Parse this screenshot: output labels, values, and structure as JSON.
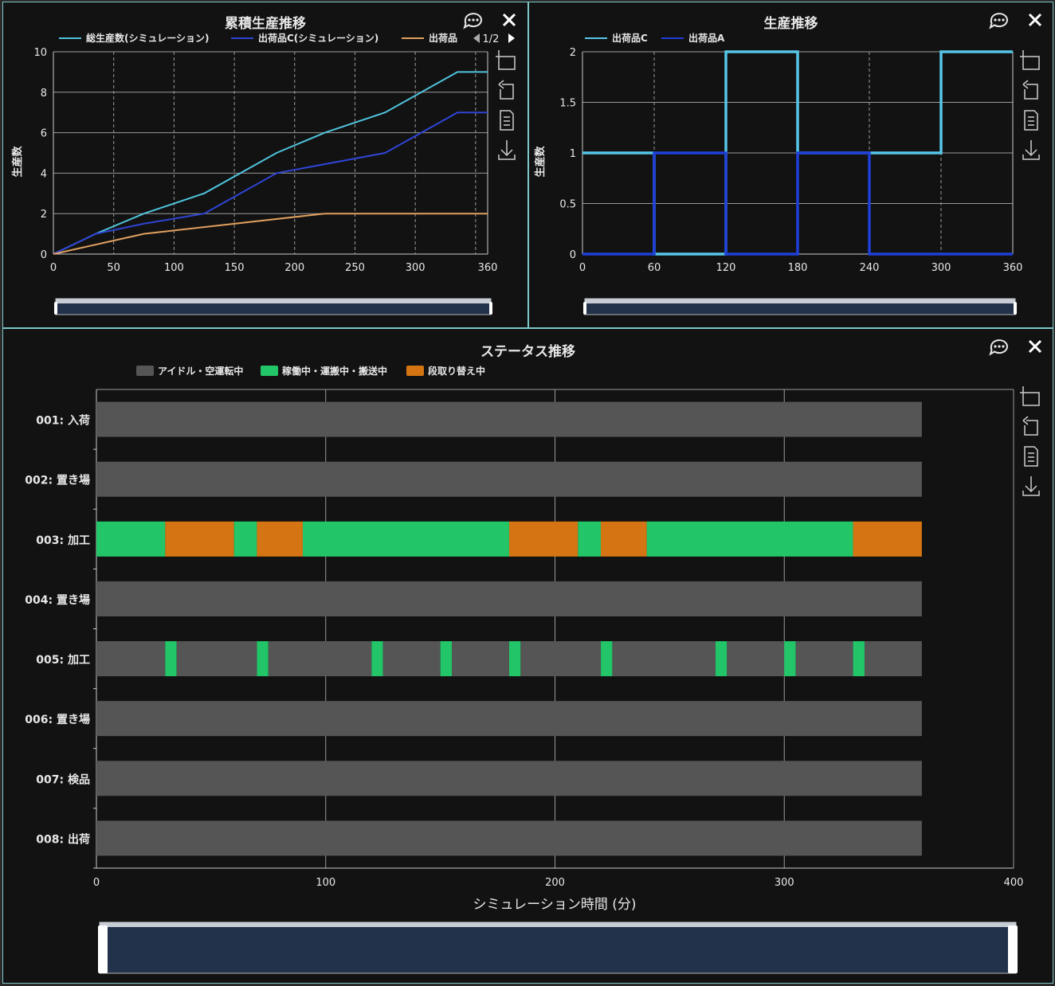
{
  "colors": {
    "total_sim": "#4fc3dc",
    "c_sim": "#2f45d6",
    "other": "#e0a060",
    "c_step": "#56c6e8",
    "a_step": "#1e3fd8",
    "idle": "#555555",
    "run": "#22c567",
    "setup": "#d57412"
  },
  "panel1": {
    "title": "累積生産推移",
    "legend_page": "1/2",
    "icons": [
      "chat-icon",
      "close-icon",
      "zoom-icon",
      "undo-zoom-icon",
      "data-view-icon",
      "download-icon"
    ],
    "chart_data": {
      "type": "line",
      "title": "累積生産推移",
      "ylabel": "生産数",
      "xlim": [
        0,
        360
      ],
      "ylim": [
        0,
        10
      ],
      "x_ticks": [
        0,
        50,
        100,
        150,
        200,
        250,
        300,
        360
      ],
      "y_ticks": [
        0,
        2,
        4,
        6,
        8,
        10
      ],
      "x_grid": [
        50,
        100,
        150,
        200,
        250,
        300,
        350
      ],
      "series": [
        {
          "name": "総生産数(シミュレーション)",
          "legend_label": "総生産数(シミュレーション)",
          "points": [
            [
              0,
              0
            ],
            [
              35,
              1
            ],
            [
              75,
              2
            ],
            [
              125,
              3
            ],
            [
              185,
              5
            ],
            [
              225,
              6
            ],
            [
              275,
              7
            ],
            [
              335,
              9
            ],
            [
              360,
              9
            ]
          ]
        },
        {
          "name": "出荷品C(シミュレーション)",
          "legend_label": "出荷品C(シミュレーション)",
          "points": [
            [
              0,
              0
            ],
            [
              35,
              1
            ],
            [
              75,
              1.5
            ],
            [
              125,
              2
            ],
            [
              185,
              4
            ],
            [
              275,
              5
            ],
            [
              335,
              7
            ],
            [
              360,
              7
            ]
          ]
        },
        {
          "name": "出荷品",
          "legend_label": "出荷品",
          "points": [
            [
              0,
              0
            ],
            [
              75,
              1
            ],
            [
              225,
              2
            ],
            [
              360,
              2
            ]
          ]
        }
      ]
    }
  },
  "panel2": {
    "title": "生産推移",
    "icons": [
      "chat-icon",
      "close-icon",
      "zoom-icon",
      "undo-zoom-icon",
      "data-view-icon",
      "download-icon"
    ],
    "chart_data": {
      "type": "line",
      "title": "生産推移",
      "ylabel": "生産数",
      "xlim": [
        0,
        360
      ],
      "ylim": [
        0,
        2
      ],
      "x_ticks": [
        0,
        60,
        120,
        180,
        240,
        300,
        360
      ],
      "y_ticks": [
        0,
        0.5,
        1,
        1.5,
        2
      ],
      "step": true,
      "series": [
        {
          "name": "出荷品C",
          "legend_label": "出荷品C",
          "points": [
            [
              0,
              1
            ],
            [
              60,
              0
            ],
            [
              120,
              2
            ],
            [
              180,
              1
            ],
            [
              240,
              1
            ],
            [
              300,
              2
            ],
            [
              360,
              2
            ]
          ]
        },
        {
          "name": "出荷品A",
          "legend_label": "出荷品A",
          "points": [
            [
              0,
              0
            ],
            [
              60,
              1
            ],
            [
              120,
              0
            ],
            [
              180,
              1
            ],
            [
              240,
              0
            ],
            [
              300,
              0
            ],
            [
              360,
              0
            ]
          ]
        }
      ]
    }
  },
  "panel3": {
    "title": "ステータス推移",
    "icons": [
      "chat-icon",
      "close-icon",
      "zoom-icon",
      "undo-zoom-icon",
      "data-view-icon",
      "download-icon"
    ],
    "chart_data": {
      "type": "bar",
      "title": "ステータス推移",
      "xlabel": "シミュレーション時間 (分)",
      "xlim": [
        0,
        400
      ],
      "x_ticks": [
        0,
        100,
        200,
        300,
        400
      ],
      "legend": [
        {
          "name": "アイドル・空運転中",
          "key": "idle"
        },
        {
          "name": "稼働中・運搬中・搬送中",
          "key": "run"
        },
        {
          "name": "段取り替え中",
          "key": "setup"
        }
      ],
      "categories": [
        "001: 入荷",
        "002: 置き場",
        "003: 加工",
        "004: 置き場",
        "005: 加工",
        "006: 置き場",
        "007: 検品",
        "008: 出荷"
      ],
      "rows": [
        [
          [
            "idle",
            0,
            360
          ]
        ],
        [
          [
            "idle",
            0,
            360
          ]
        ],
        [
          [
            "run",
            0,
            30
          ],
          [
            "setup",
            30,
            60
          ],
          [
            "run",
            60,
            70
          ],
          [
            "setup",
            70,
            90
          ],
          [
            "run",
            90,
            180
          ],
          [
            "setup",
            180,
            210
          ],
          [
            "run",
            210,
            220
          ],
          [
            "setup",
            220,
            240
          ],
          [
            "run",
            240,
            330
          ],
          [
            "setup",
            330,
            360
          ]
        ],
        [
          [
            "idle",
            0,
            360
          ]
        ],
        [
          [
            "idle",
            0,
            30
          ],
          [
            "run",
            30,
            35
          ],
          [
            "idle",
            35,
            70
          ],
          [
            "run",
            70,
            75
          ],
          [
            "idle",
            75,
            120
          ],
          [
            "run",
            120,
            125
          ],
          [
            "idle",
            125,
            150
          ],
          [
            "run",
            150,
            155
          ],
          [
            "idle",
            155,
            180
          ],
          [
            "run",
            180,
            185
          ],
          [
            "idle",
            185,
            220
          ],
          [
            "run",
            220,
            225
          ],
          [
            "idle",
            225,
            270
          ],
          [
            "run",
            270,
            275
          ],
          [
            "idle",
            275,
            300
          ],
          [
            "run",
            300,
            305
          ],
          [
            "idle",
            305,
            330
          ],
          [
            "run",
            330,
            335
          ],
          [
            "idle",
            335,
            360
          ]
        ],
        [
          [
            "idle",
            0,
            360
          ]
        ],
        [
          [
            "idle",
            0,
            360
          ]
        ],
        [
          [
            "idle",
            0,
            360
          ]
        ]
      ]
    }
  }
}
